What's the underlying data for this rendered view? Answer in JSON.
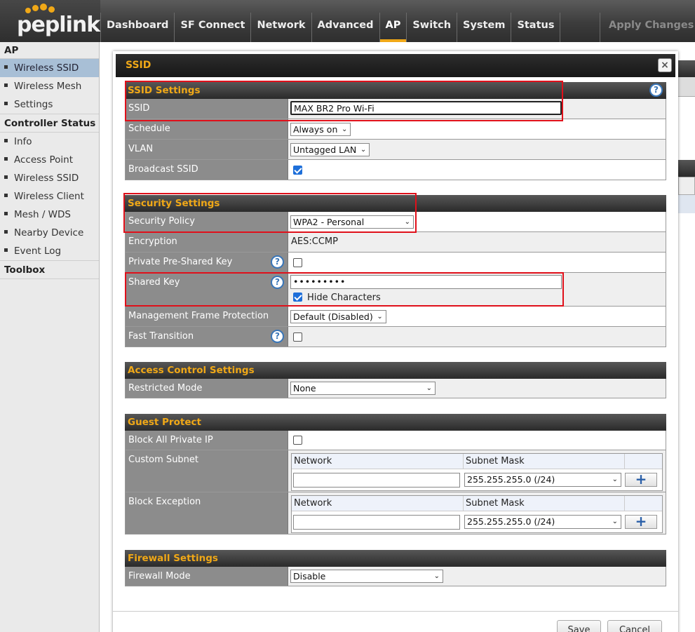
{
  "brand": {
    "logo_text": "peplink",
    "accent": "#f0a817"
  },
  "nav": {
    "tabs": [
      "Dashboard",
      "SF Connect",
      "Network",
      "Advanced",
      "AP",
      "Switch",
      "System",
      "Status"
    ],
    "active": "AP",
    "apply_label": "Apply Changes"
  },
  "sidebar": {
    "ap_title": "AP",
    "ap_items": [
      "Wireless SSID",
      "Wireless Mesh",
      "Settings"
    ],
    "controller_title": "Controller Status",
    "controller_items": [
      "Info",
      "Access Point",
      "Wireless SSID",
      "Wireless Client",
      "Mesh / WDS",
      "Nearby Device",
      "Event Log"
    ],
    "toolbox_title": "Toolbox"
  },
  "modal": {
    "title": "SSID",
    "close_glyph": "×"
  },
  "ssid_settings": {
    "title": "SSID Settings",
    "ssid_label": "SSID",
    "ssid_value": "MAX BR2 Pro Wi-Fi",
    "schedule_label": "Schedule",
    "schedule_value": "Always on",
    "vlan_label": "VLAN",
    "vlan_value": "Untagged LAN",
    "broadcast_label": "Broadcast SSID",
    "broadcast_checked": true
  },
  "security_settings": {
    "title": "Security Settings",
    "policy_label": "Security Policy",
    "policy_value": "WPA2 - Personal",
    "encryption_label": "Encryption",
    "encryption_value": "AES:CCMP",
    "ppsk_label": "Private Pre-Shared Key",
    "shared_key_label": "Shared Key",
    "shared_key_value": "•••••••••",
    "hide_chars_label": "Hide Characters",
    "mfp_label": "Management Frame Protection",
    "mfp_value": "Default (Disabled)",
    "fast_transition_label": "Fast Transition"
  },
  "access_control": {
    "title": "Access Control Settings",
    "restricted_label": "Restricted Mode",
    "restricted_value": "None"
  },
  "guest_protect": {
    "title": "Guest Protect",
    "block_private_label": "Block All Private IP",
    "custom_subnet_label": "Custom Subnet",
    "block_exception_label": "Block Exception",
    "network_header": "Network",
    "mask_header": "Subnet Mask",
    "mask_value": "255.255.255.0 (/24)",
    "plus_glyph": "+"
  },
  "firewall": {
    "title": "Firewall Settings",
    "mode_label": "Firewall Mode",
    "mode_value": "Disable"
  },
  "actions": {
    "save_label": "Save",
    "cancel_label": "Cancel"
  },
  "help_glyph": "?",
  "caret_glyph": "⌄"
}
